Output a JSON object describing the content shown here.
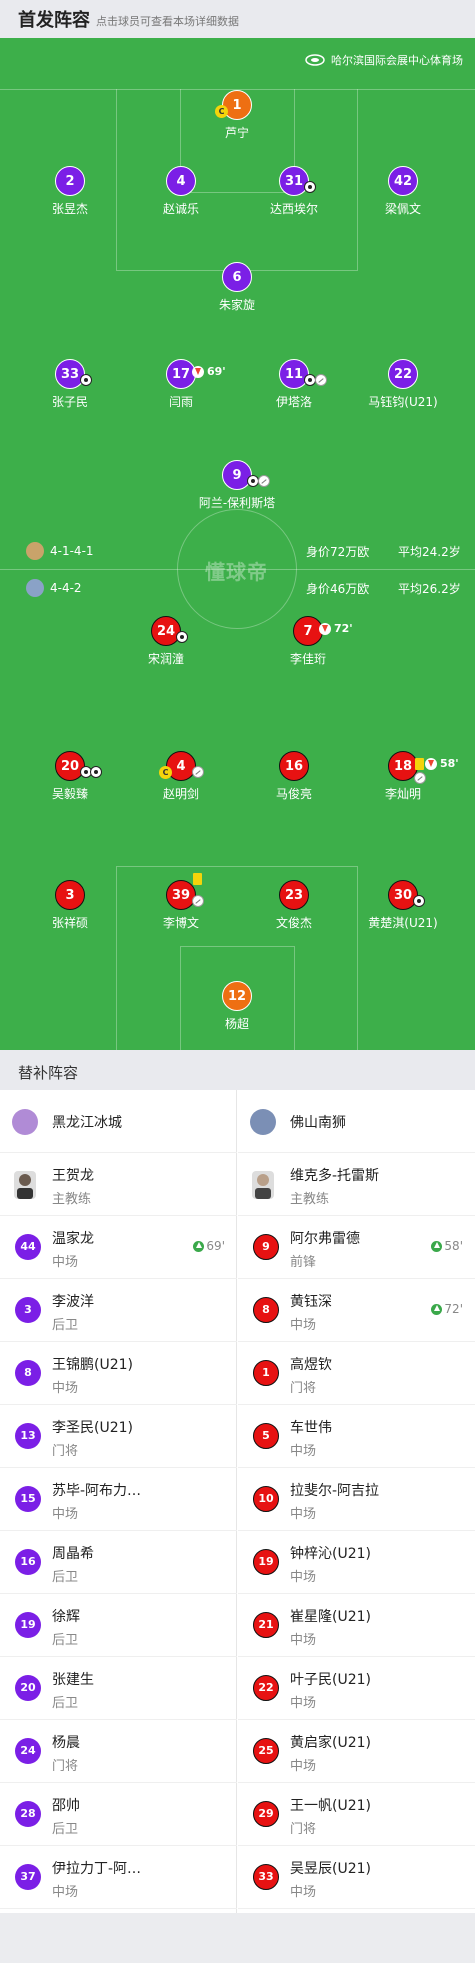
{
  "header": {
    "title": "首发阵容",
    "subtitle": "点击球员可查看本场详细数据"
  },
  "venue": "哈尔滨国际会展中心体育场",
  "watermark": "懂球帝",
  "home_team": {
    "formation": "4-1-4-1",
    "value": "身价72万欧",
    "avg_age": "平均24.2岁"
  },
  "away_team": {
    "formation": "4-4-2",
    "value": "身价46万欧",
    "avg_age": "平均26.2岁"
  },
  "home_players": [
    {
      "num": "1",
      "name": "芦宁"
    },
    {
      "num": "2",
      "name": "张昱杰"
    },
    {
      "num": "4",
      "name": "赵诚乐"
    },
    {
      "num": "31",
      "name": "达西埃尔"
    },
    {
      "num": "42",
      "name": "梁佩文"
    },
    {
      "num": "6",
      "name": "朱家旋"
    },
    {
      "num": "33",
      "name": "张子民"
    },
    {
      "num": "17",
      "name": "闫雨",
      "min": "69'"
    },
    {
      "num": "11",
      "name": "伊塔洛"
    },
    {
      "num": "22",
      "name": "马钰钧(U21)"
    },
    {
      "num": "9",
      "name": "阿兰-保利斯塔"
    }
  ],
  "away_players": [
    {
      "num": "24",
      "name": "宋润潼"
    },
    {
      "num": "7",
      "name": "李佳珩",
      "min": "72'"
    },
    {
      "num": "20",
      "name": "吴毅臻"
    },
    {
      "num": "4",
      "name": "赵明剑"
    },
    {
      "num": "16",
      "name": "马俊亮"
    },
    {
      "num": "18",
      "name": "李灿明",
      "min": "58'"
    },
    {
      "num": "3",
      "name": "张祥硕"
    },
    {
      "num": "39",
      "name": "李博文"
    },
    {
      "num": "23",
      "name": "文俊杰"
    },
    {
      "num": "30",
      "name": "黄楚淇(U21)"
    },
    {
      "num": "12",
      "name": "杨超"
    }
  ],
  "captain_mark": "C",
  "subs_title": "替补阵容",
  "subs_left": {
    "team": "黑龙江冰城",
    "coach": {
      "name": "王贺龙",
      "role": "主教练"
    },
    "players": [
      {
        "num": "44",
        "name": "温家龙",
        "pos": "中场",
        "sub_in": "69'"
      },
      {
        "num": "3",
        "name": "李波洋",
        "pos": "后卫"
      },
      {
        "num": "8",
        "name": "王锦鹏(U21)",
        "pos": "中场"
      },
      {
        "num": "13",
        "name": "李圣民(U21)",
        "pos": "门将"
      },
      {
        "num": "15",
        "name": "苏毕-阿布力…",
        "pos": "中场"
      },
      {
        "num": "16",
        "name": "周晶希",
        "pos": "后卫"
      },
      {
        "num": "19",
        "name": "徐辉",
        "pos": "后卫"
      },
      {
        "num": "20",
        "name": "张建生",
        "pos": "后卫"
      },
      {
        "num": "24",
        "name": "杨晨",
        "pos": "门将"
      },
      {
        "num": "28",
        "name": "邵帅",
        "pos": "后卫"
      },
      {
        "num": "37",
        "name": "伊拉力丁-阿…",
        "pos": "中场"
      }
    ]
  },
  "subs_right": {
    "team": "佛山南狮",
    "coach": {
      "name": "维克多-托雷斯",
      "role": "主教练"
    },
    "players": [
      {
        "num": "9",
        "name": "阿尔弗雷德",
        "pos": "前锋",
        "sub_in": "58'"
      },
      {
        "num": "8",
        "name": "黄钰深",
        "pos": "中场",
        "sub_in": "72'"
      },
      {
        "num": "1",
        "name": "高煜钦",
        "pos": "门将"
      },
      {
        "num": "5",
        "name": "车世伟",
        "pos": "中场"
      },
      {
        "num": "10",
        "name": "拉斐尔-阿吉拉",
        "pos": "中场"
      },
      {
        "num": "19",
        "name": "钟梓沁(U21)",
        "pos": "中场"
      },
      {
        "num": "21",
        "name": "崔星隆(U21)",
        "pos": "中场"
      },
      {
        "num": "22",
        "name": "叶子民(U21)",
        "pos": "中场"
      },
      {
        "num": "25",
        "name": "黄启家(U21)",
        "pos": "中场"
      },
      {
        "num": "29",
        "name": "王一帆(U21)",
        "pos": "门将"
      },
      {
        "num": "33",
        "name": "吴昱辰(U21)",
        "pos": "中场"
      }
    ]
  },
  "colors": {
    "pitch": "#3daf4a",
    "home": "#7b1fe6",
    "gk_home": "#ee6f12",
    "away": "#e71212",
    "gk_away": "#ee6f12"
  }
}
